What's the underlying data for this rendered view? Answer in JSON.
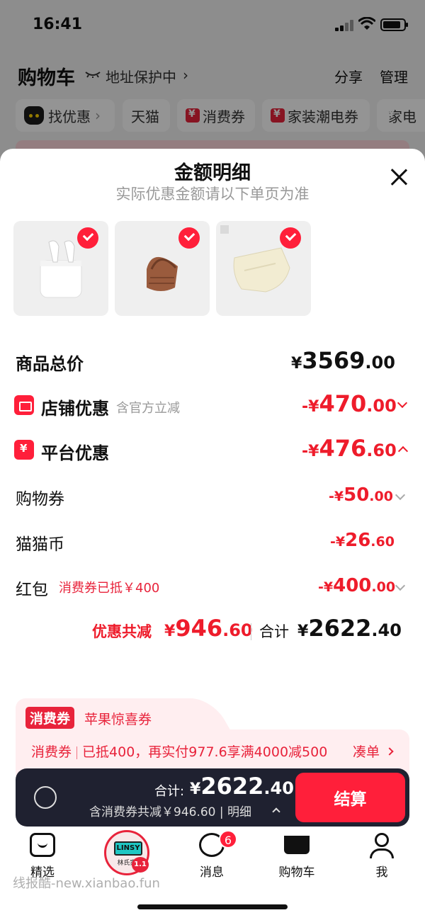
{
  "status_bar": {
    "time": "16:41"
  },
  "header": {
    "title": "购物车",
    "address": "地址保护中",
    "share": "分享",
    "manage": "管理"
  },
  "chips": [
    "找优惠",
    "天猫",
    "消费券",
    "家装潮电券",
    "家电"
  ],
  "sheet": {
    "title": "金额明细",
    "subtitle": "实际优惠金额请以下单页为准",
    "products": [
      {
        "name": "airpods",
        "checked": true
      },
      {
        "name": "brown-bag",
        "checked": true
      },
      {
        "name": "cream-bag",
        "checked": true
      }
    ],
    "goods_total": {
      "label": "商品总价",
      "cur": "¥",
      "int": "3569",
      "dec": ".00"
    },
    "shop_discount": {
      "label": "店铺优惠",
      "note": "含官方立减",
      "cur": "-¥",
      "int": "470",
      "dec": ".00"
    },
    "platform_discount": {
      "label": "平台优惠",
      "cur": "-¥",
      "int": "476",
      "dec": ".60"
    },
    "shopping_coupon": {
      "label": "购物券",
      "cur": "-¥",
      "int": "50",
      "dec": ".00"
    },
    "cat_coin": {
      "label": "猫猫币",
      "cur": "-¥",
      "int": "26",
      "dec": ".60"
    },
    "red_packet": {
      "label": "红包",
      "note": "消费券已抵￥400",
      "cur": "-¥",
      "int": "400",
      "dec": ".00"
    },
    "summary": {
      "discount_label": "优惠共减",
      "discount_cur": "¥",
      "discount_int": "946",
      "discount_dec": ".60",
      "total_label": "合计",
      "total_cur": "¥",
      "total_int": "2622",
      "total_dec": ".40"
    }
  },
  "coupon": {
    "badge": "消费券",
    "name": "苹果惊喜券",
    "tag": "消费券",
    "text": "已抵400，再实付977.6享满4000减500",
    "link": "凑单"
  },
  "checkout": {
    "label": "合计:",
    "cur": "¥",
    "int": "2622",
    "dec": ".40",
    "sub": "含消费券共减￥946.60 | 明细",
    "button": "结算"
  },
  "tabbar": {
    "home": "精选",
    "avatar_screen": "LINSY",
    "avatar_name": "林氏家",
    "messages": "消息",
    "message_badge": "6",
    "cart": "购物车",
    "me": "我"
  },
  "watermark": "线报酷-new.xianbao.fun",
  "colors": {
    "accent": "#ff1f3a",
    "price_red": "#ee1c2b",
    "checkout_bg": "#1f2130",
    "coupon_bg": "#ffeef0"
  }
}
